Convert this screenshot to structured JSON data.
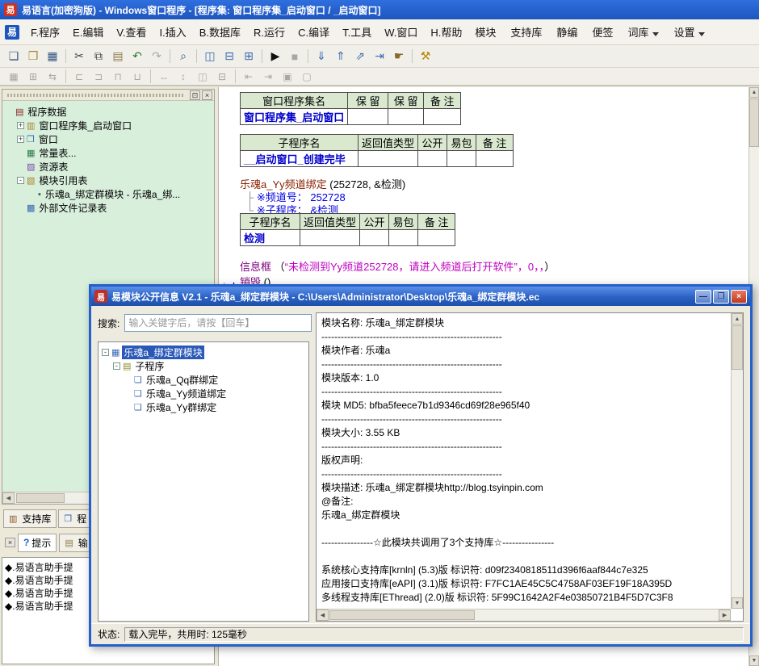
{
  "titlebar": {
    "logo": "易",
    "title": "易语言(加密狗版) - Windows窗口程序 - [程序集: 窗口程序集_启动窗口 / _启动窗口]"
  },
  "menubar": {
    "logo": "易",
    "items": [
      "F.程序",
      "E.编辑",
      "V.查看",
      "I.插入",
      "B.数据库",
      "R.运行",
      "C.编译",
      "T.工具",
      "W.窗口",
      "H.帮助"
    ],
    "right_items": [
      {
        "label": "模块",
        "arrow": false
      },
      {
        "label": "支持库",
        "arrow": false
      },
      {
        "label": "静编",
        "arrow": false
      },
      {
        "label": "便签",
        "arrow": false
      },
      {
        "label": "词库",
        "arrow": true
      },
      {
        "label": "设置",
        "arrow": true
      }
    ]
  },
  "icons": {
    "left": "◀",
    "right": "▶",
    "up": "▲",
    "down": "▼"
  },
  "tree_panel": {
    "pin_glyph": "⊡",
    "close_glyph": "×"
  },
  "toolbar_main": [
    {
      "name": "new",
      "glyph": "❏",
      "color": "#33557f"
    },
    {
      "name": "open",
      "glyph": "❒",
      "color": "#a8842c"
    },
    {
      "name": "save",
      "glyph": "▦",
      "color": "#33557f"
    },
    {
      "sep": true
    },
    {
      "name": "cut",
      "glyph": "✂",
      "color": "#444444"
    },
    {
      "name": "copy",
      "glyph": "⧉",
      "color": "#444444"
    },
    {
      "name": "paste",
      "glyph": "▤",
      "color": "#8a7a4a"
    },
    {
      "name": "undo",
      "glyph": "↶",
      "color": "#2a7a2a"
    },
    {
      "name": "redo",
      "glyph": "↷",
      "color": "#aaaaaa",
      "disabled": true
    },
    {
      "sep": true
    },
    {
      "name": "find",
      "glyph": "⌕",
      "color": "#33557f"
    },
    {
      "sep": true
    },
    {
      "name": "view-code",
      "glyph": "◫",
      "color": "#3a6ab0"
    },
    {
      "name": "view-split",
      "glyph": "⊟",
      "color": "#3a6ab0"
    },
    {
      "name": "view-form",
      "glyph": "⊞",
      "color": "#3a6ab0"
    },
    {
      "sep": true
    },
    {
      "name": "run",
      "glyph": "▶",
      "color": "#111111"
    },
    {
      "name": "stop",
      "glyph": "■",
      "color": "#aaaaaa",
      "disabled": true
    },
    {
      "sep": true
    },
    {
      "name": "step-into",
      "glyph": "⇓",
      "color": "#3a6ab0"
    },
    {
      "name": "step-over",
      "glyph": "⇑",
      "color": "#3a6ab0"
    },
    {
      "name": "step-out",
      "glyph": "⇗",
      "color": "#3a6ab0"
    },
    {
      "name": "run-to-cursor",
      "glyph": "⇥",
      "color": "#3a6ab0"
    },
    {
      "name": "pan-hand",
      "glyph": "☛",
      "color": "#8a6a2a"
    },
    {
      "sep": true
    },
    {
      "name": "static-compile",
      "glyph": "⚒",
      "color": "#b8860b"
    }
  ],
  "toolbar_form": [
    {
      "name": "grid",
      "glyph": "▦"
    },
    {
      "name": "snap",
      "glyph": "⊞"
    },
    {
      "name": "tab-order",
      "glyph": "⇆"
    },
    {
      "sep": true
    },
    {
      "name": "align-left",
      "glyph": "⊏"
    },
    {
      "name": "align-right",
      "glyph": "⊐"
    },
    {
      "name": "align-top",
      "glyph": "⊓"
    },
    {
      "name": "align-bottom",
      "glyph": "⊔"
    },
    {
      "sep": true
    },
    {
      "name": "same-width",
      "glyph": "↔"
    },
    {
      "name": "same-height",
      "glyph": "↕"
    },
    {
      "name": "center-horizontal",
      "glyph": "◫"
    },
    {
      "name": "center-vertical",
      "glyph": "⊟"
    },
    {
      "sep": true
    },
    {
      "name": "space-horizontal",
      "glyph": "⇤"
    },
    {
      "name": "space-vertical",
      "glyph": "⇥"
    },
    {
      "name": "bring-to-front",
      "glyph": "▣"
    },
    {
      "name": "send-to-back",
      "glyph": "▢"
    }
  ],
  "project_tree": {
    "items": [
      {
        "label": "程序数据",
        "icon": "▤",
        "icon_color": "#8b2520",
        "icon_name": "program-data-icon",
        "level": 0
      },
      {
        "label": "窗口程序集_启动窗口",
        "icon": "▥",
        "icon_color": "#a8842c",
        "icon_name": "window-assembly-icon",
        "level": 1,
        "exp": "+"
      },
      {
        "label": "窗口",
        "icon": "❒",
        "icon_color": "#3a6ab0",
        "icon_name": "window-icon",
        "level": 1,
        "exp": "+"
      },
      {
        "label": "常量表...",
        "icon": "▦",
        "icon_color": "#2a7a4a",
        "icon_name": "constants-table-icon",
        "level": 1
      },
      {
        "label": "资源表",
        "icon": "▨",
        "icon_color": "#7a4aa8",
        "icon_name": "resource-table-icon",
        "level": 1
      },
      {
        "label": "模块引用表",
        "icon": "▧",
        "icon_color": "#a8842c",
        "icon_name": "module-reference-table-icon",
        "level": 1,
        "exp": "-"
      },
      {
        "label": "乐魂a_绑定群模块 - 乐魂a_绑...",
        "icon": "▪",
        "icon_color": "#555555",
        "icon_name": "module-item-icon",
        "level": 2
      },
      {
        "label": "外部文件记录表",
        "icon": "▩",
        "icon_color": "#3a6ab0",
        "icon_name": "external-file-table-icon",
        "level": 1
      }
    ]
  },
  "editor": {
    "table1": {
      "headers": [
        "窗口程序集名",
        "保 留",
        "保 留",
        "备 注"
      ],
      "row": [
        "窗口程序集_启动窗口",
        "",
        "",
        ""
      ]
    },
    "table2": {
      "headers": [
        "子程序名",
        "返回值类型",
        "公开",
        "易包",
        "备 注"
      ],
      "row": [
        "__启动窗口_创建完毕",
        "",
        "",
        "",
        ""
      ]
    },
    "table3": {
      "headers": [
        "子程序名",
        "返回值类型",
        "公开",
        "易包",
        "备 注"
      ],
      "row": [
        "检测",
        "",
        "",
        "",
        ""
      ]
    },
    "call_name": "乐魂a_Yy频道绑定",
    "call_args": " (252728, &检测)",
    "cmt_prefix1": "├ ",
    "comment1": "※频道号： 252728",
    "cmt_prefix2": "└ ",
    "comment2": "※子程序： &检测",
    "msg_name": "信息框",
    "msg_open": " （",
    "msg_str": "“未检测到Yy频道252728，请进入频道后打开软件”",
    "msg_rest": "，0，，",
    "msg_close": "）",
    "destroy_name": "销毁",
    "destroy_args": " ()",
    "margin_down": "↓",
    "margin_plus": "+"
  },
  "bottom": {
    "tab_support": "支持库",
    "tab_support_icon": "▥",
    "tab_project": "程",
    "tab_project_icon": "❒",
    "close_glyph": "×",
    "help_glyph": "?",
    "tab_hint": "提示",
    "tab_output": "输",
    "tab_output_icon": "▤",
    "hint_items": [
      "◆.易语言助手提",
      "◆.易语言助手提",
      "◆.易语言助手提",
      "◆.易语言助手提"
    ]
  },
  "dialog": {
    "logo": "易",
    "title": "易模块公开信息 V2.1 - 乐魂a_绑定群模块 - C:\\Users\\Administrator\\Desktop\\乐魂a_绑定群模块.ec",
    "buttons": {
      "minimize": "—",
      "maximize": "❐",
      "close": "×"
    },
    "search_label": "搜索:",
    "search_placeholder": "输入关键字后，请按【回车】",
    "tree": [
      {
        "label": "乐魂a_绑定群模块",
        "icon": "▦",
        "icon_color": "#3a6ab0",
        "icon_name": "module-icon",
        "level": 0,
        "exp": "-",
        "selected": true
      },
      {
        "label": "子程序",
        "icon": "▤",
        "icon_color": "#8a8a2a",
        "icon_name": "subroutine-folder-icon",
        "level": 1,
        "exp": "-"
      },
      {
        "label": "乐魂a_Qq群绑定",
        "icon": "❏",
        "icon_color": "#3a6ab0",
        "icon_name": "subroutine-icon",
        "level": 2
      },
      {
        "label": "乐魂a_Yy频道绑定",
        "icon": "❏",
        "icon_color": "#3a6ab0",
        "icon_name": "subroutine-icon",
        "level": 2
      },
      {
        "label": "乐魂a_Yy群绑定",
        "icon": "❏",
        "icon_color": "#3a6ab0",
        "icon_name": "subroutine-icon",
        "level": 2
      }
    ],
    "info_lines": [
      "模块名称: 乐魂a_绑定群模块",
      "--------------------------------------------------------",
      "模块作者: 乐魂a",
      "--------------------------------------------------------",
      "模块版本: 1.0",
      "--------------------------------------------------------",
      "模块 MD5: bfba5feece7b1d9346cd69f28e965f40",
      "--------------------------------------------------------",
      "模块大小: 3.55 KB",
      "--------------------------------------------------------",
      "版权声明:",
      "--------------------------------------------------------",
      "模块描述: 乐魂a_绑定群模块http://blog.tsyinpin.com",
      "@备注:",
      "乐魂a_绑定群模块",
      "",
      "----------------☆此模块共调用了3个支持库☆----------------",
      "",
      "系统核心支持库[krnln] (5.3)版 标识符: d09f2340818511d396f6aaf844c7e325",
      "应用接口支持库[eAPI] (3.1)版 标识符: F7FC1AE45C5C4758AF03EF19F18A395D",
      "多线程支持库[EThread] (2.0)版 标识符: 5F99C1642A2F4e03850721B4F5D7C3F8"
    ],
    "status_label": "状态:",
    "status_text": "载入完毕，共用时: 125毫秒"
  }
}
